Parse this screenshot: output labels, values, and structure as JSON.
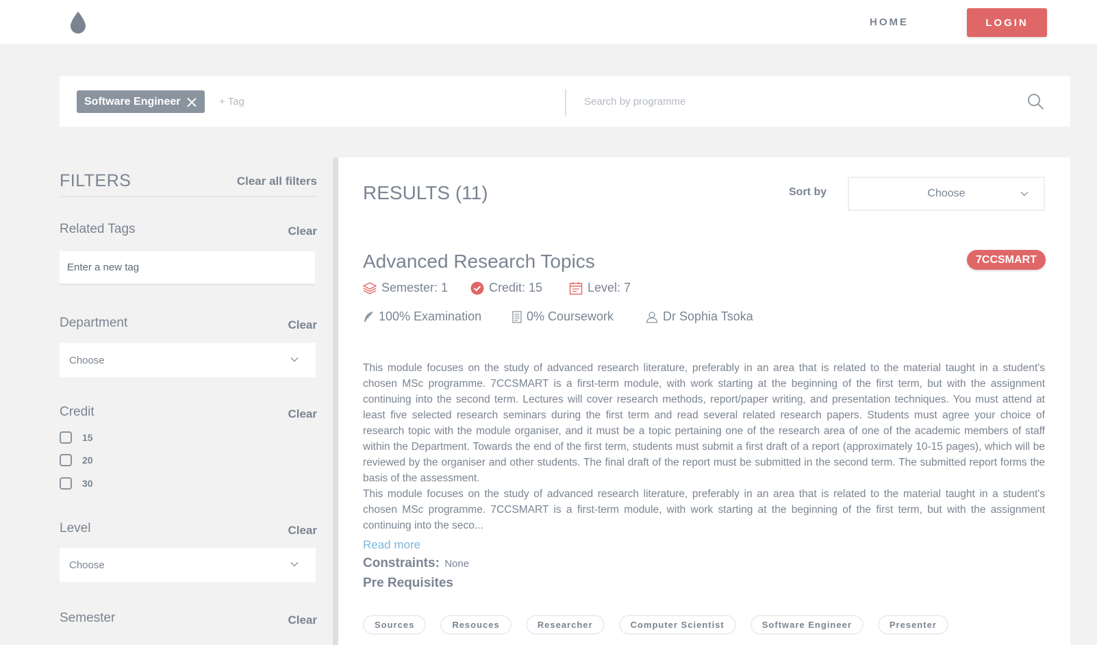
{
  "header": {
    "logo_icon": "drop-icon",
    "home_label": "HOME",
    "login_label": "LOGIN",
    "accent_color": "#e06767"
  },
  "search": {
    "active_tag": "Software Engineer",
    "tag_placeholder": "+ Tag",
    "programme_placeholder": "Search by programme",
    "search_icon": "search-icon"
  },
  "filters": {
    "title": "FILTERS",
    "clear_all_label": "Clear all filters",
    "clear_label": "Clear",
    "related_tags": {
      "heading": "Related Tags",
      "placeholder": "Enter a new tag"
    },
    "department": {
      "heading": "Department",
      "selected": "Choose"
    },
    "credit": {
      "heading": "Credit",
      "options": [
        "15",
        "20",
        "30"
      ]
    },
    "level": {
      "heading": "Level",
      "selected": "Choose"
    },
    "semester": {
      "heading": "Semester"
    }
  },
  "results": {
    "title": "RESULTS (11)",
    "sort_label": "Sort by",
    "sort_selected": "Choose",
    "course": {
      "title": "Advanced Research Topics",
      "code": "7CCSMART",
      "semester": "Semester: 1",
      "credit": "Credit: 15",
      "level": "Level: 7",
      "examination": "100% Examination",
      "coursework": "0% Coursework",
      "lecturer": "Dr Sophia Tsoka",
      "description_1": "This module focuses on the study of advanced research literature, preferably in an area that is related to the material taught in a student's chosen MSc programme. 7CCSMART is a first-term module, with work starting at the beginning of the first term, but with the assignment continuing into the second term. Lectures will cover research methods, report/paper writing, and presentation techniques. You must attend at least five selected research seminars during the first term and read several related research papers. Students must agree your choice of research topic with the module organiser, and it must be a topic pertaining one of the research area of one of the academic members of staff within the Department. Towards the end of the first term, students must submit a first draft of a report (approximately 10-15 pages), which will be reviewed by the organiser and other students. The final draft of the report must be submitted in the second term. The submitted report forms the basis of the assessment.",
      "description_2": "This module focuses on the study of advanced research literature, preferably in an area that is related to the material taught in a student's chosen MSc programme. 7CCSMART is a first-term module, with work starting at the beginning of the first term, but with the assignment continuing into the seco...",
      "read_more": "Read more",
      "constraints_label": "Constraints:",
      "constraints_value": "None",
      "prerequisites_label": "Pre Requisites",
      "tags": [
        "Sources",
        "Resouces",
        "Researcher",
        "Computer Scientist",
        "Software Engineer",
        "Presenter"
      ]
    }
  }
}
